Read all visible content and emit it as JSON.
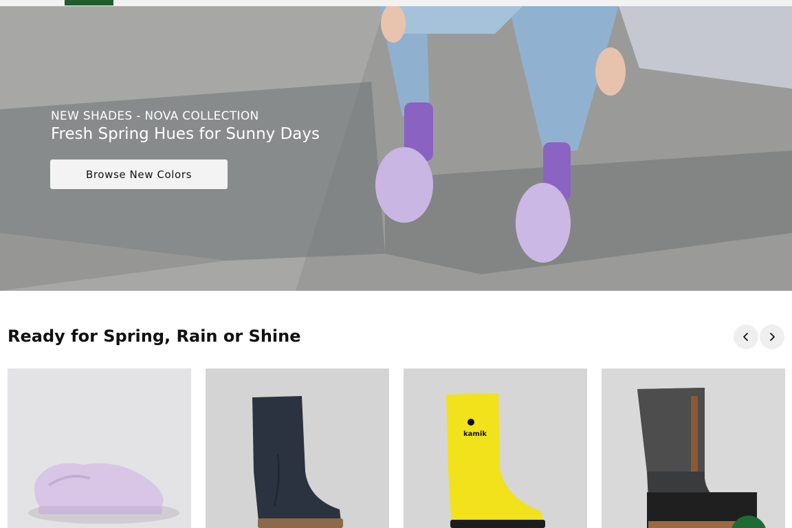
{
  "hero": {
    "eyebrow": "NEW SHADES - NOVA COLLECTION",
    "headline": "Fresh Spring Hues for Sunny Days",
    "cta_label": "Browse New Colors"
  },
  "section": {
    "title": "Ready for Spring, Rain or Shine"
  },
  "carousel": {
    "products": [
      {
        "image": "lavender-clog"
      },
      {
        "image": "navy-rain-boot"
      },
      {
        "image": "yellow-kamik-rain-boot",
        "logo_text": "kamik"
      },
      {
        "image": "black-quilted-winter-boot"
      }
    ]
  },
  "icons": {
    "prev": "chevron-left-icon",
    "next": "chevron-right-icon"
  },
  "colors": {
    "brand_green": "#1f5e2c",
    "button_bg": "#f3f3f3",
    "hero_text": "#ffffff"
  }
}
